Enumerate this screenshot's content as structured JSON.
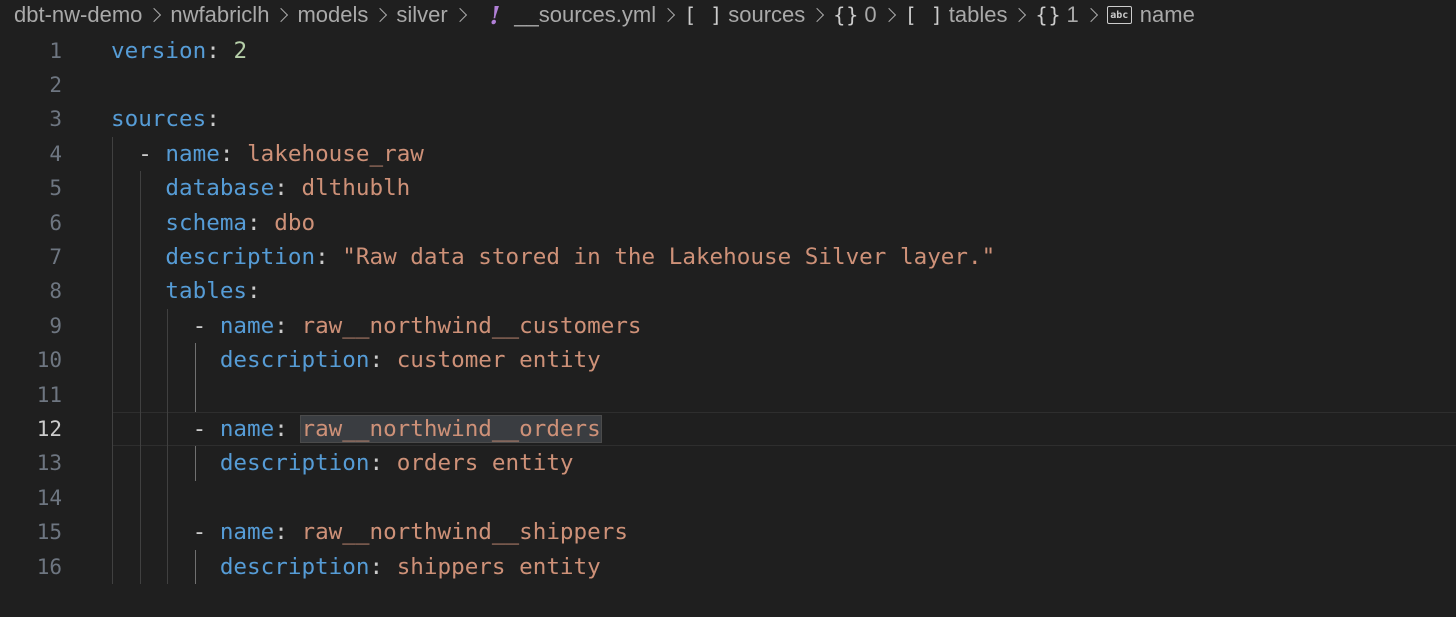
{
  "breadcrumb": {
    "items": [
      {
        "label": "dbt-nw-demo"
      },
      {
        "label": "nwfabriclh"
      },
      {
        "label": "models"
      },
      {
        "label": "silver"
      },
      {
        "label": "__sources.yml",
        "icon": "yaml-file-icon",
        "icon_glyph": "!"
      },
      {
        "label": "sources",
        "icon": "array-icon",
        "icon_glyph": "[ ]"
      },
      {
        "label": "0",
        "icon": "object-icon",
        "icon_glyph": "{}"
      },
      {
        "label": "tables",
        "icon": "array-icon",
        "icon_glyph": "[ ]"
      },
      {
        "label": "1",
        "icon": "object-icon",
        "icon_glyph": "{}"
      },
      {
        "label": "name",
        "icon": "string-icon",
        "icon_glyph": "abc"
      }
    ]
  },
  "editor": {
    "active_line": 12,
    "lines": [
      {
        "num": "1",
        "tokens": [
          {
            "t": "version",
            "c": "key"
          },
          {
            "t": ": ",
            "c": "punc"
          },
          {
            "t": "2",
            "c": "num"
          }
        ]
      },
      {
        "num": "2",
        "tokens": []
      },
      {
        "num": "3",
        "tokens": [
          {
            "t": "sources",
            "c": "key"
          },
          {
            "t": ":",
            "c": "punc"
          }
        ]
      },
      {
        "num": "4",
        "tokens": [
          {
            "t": "  - ",
            "c": "dash"
          },
          {
            "t": "name",
            "c": "key"
          },
          {
            "t": ": ",
            "c": "punc"
          },
          {
            "t": "lakehouse_raw",
            "c": "str"
          }
        ]
      },
      {
        "num": "5",
        "tokens": [
          {
            "t": "    ",
            "c": "punc"
          },
          {
            "t": "database",
            "c": "key"
          },
          {
            "t": ": ",
            "c": "punc"
          },
          {
            "t": "dlthublh",
            "c": "str"
          }
        ]
      },
      {
        "num": "6",
        "tokens": [
          {
            "t": "    ",
            "c": "punc"
          },
          {
            "t": "schema",
            "c": "key"
          },
          {
            "t": ": ",
            "c": "punc"
          },
          {
            "t": "dbo",
            "c": "str"
          }
        ]
      },
      {
        "num": "7",
        "tokens": [
          {
            "t": "    ",
            "c": "punc"
          },
          {
            "t": "description",
            "c": "key"
          },
          {
            "t": ": ",
            "c": "punc"
          },
          {
            "t": "\"Raw data stored in the Lakehouse Silver layer.\"",
            "c": "str"
          }
        ]
      },
      {
        "num": "8",
        "tokens": [
          {
            "t": "    ",
            "c": "punc"
          },
          {
            "t": "tables",
            "c": "key"
          },
          {
            "t": ":",
            "c": "punc"
          }
        ]
      },
      {
        "num": "9",
        "tokens": [
          {
            "t": "      - ",
            "c": "dash"
          },
          {
            "t": "name",
            "c": "key"
          },
          {
            "t": ": ",
            "c": "punc"
          },
          {
            "t": "raw__northwind__customers",
            "c": "str"
          }
        ]
      },
      {
        "num": "10",
        "tokens": [
          {
            "t": "        ",
            "c": "punc"
          },
          {
            "t": "description",
            "c": "key"
          },
          {
            "t": ": ",
            "c": "punc"
          },
          {
            "t": "customer entity",
            "c": "str"
          }
        ]
      },
      {
        "num": "11",
        "tokens": []
      },
      {
        "num": "12",
        "tokens": [
          {
            "t": "      - ",
            "c": "dash"
          },
          {
            "t": "name",
            "c": "key"
          },
          {
            "t": ": ",
            "c": "punc"
          },
          {
            "t": "raw__northwind__orders",
            "c": "str",
            "sel": true
          }
        ]
      },
      {
        "num": "13",
        "tokens": [
          {
            "t": "        ",
            "c": "punc"
          },
          {
            "t": "description",
            "c": "key"
          },
          {
            "t": ": ",
            "c": "punc"
          },
          {
            "t": "orders entity",
            "c": "str"
          }
        ]
      },
      {
        "num": "14",
        "tokens": []
      },
      {
        "num": "15",
        "tokens": [
          {
            "t": "      - ",
            "c": "dash"
          },
          {
            "t": "name",
            "c": "key"
          },
          {
            "t": ": ",
            "c": "punc"
          },
          {
            "t": "raw__northwind__shippers",
            "c": "str"
          }
        ]
      },
      {
        "num": "16",
        "tokens": [
          {
            "t": "        ",
            "c": "punc"
          },
          {
            "t": "description",
            "c": "key"
          },
          {
            "t": ": ",
            "c": "punc"
          },
          {
            "t": "shippers entity",
            "c": "str"
          }
        ]
      }
    ]
  },
  "colors": {
    "background": "#1f1f1f",
    "key": "#569cd6",
    "string": "#ce9178",
    "number": "#b5cea8",
    "line_number": "#6e7681",
    "active_line_number": "#cccccc"
  }
}
